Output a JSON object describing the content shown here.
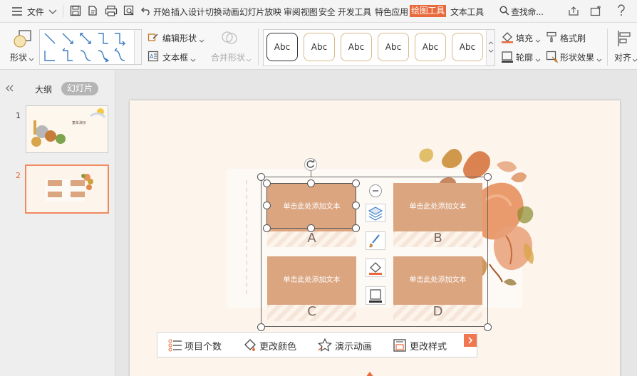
{
  "menubar": {
    "file_label": "文件",
    "tabs": [
      "开始",
      "插入",
      "设计",
      "切换",
      "动画",
      "幻灯片放映",
      "审阅",
      "视图",
      "安全",
      "开发工具",
      "特色应用",
      "绘图工具",
      "文本工具"
    ],
    "search_label": "查找命..."
  },
  "ribbon": {
    "shape_label": "形状",
    "edit_shape_label": "编辑形状",
    "textbox_label": "文本框",
    "merge_shape_label": "合并形状",
    "style_samples": [
      "Abc",
      "Abc",
      "Abc",
      "Abc",
      "Abc",
      "Abc"
    ],
    "fill_label": "填充",
    "format_painter_label": "格式刷",
    "outline_label": "轮廓",
    "shape_effect_label": "形状效果",
    "align_label": "对齐"
  },
  "left_panel": {
    "tab_outline": "大纲",
    "tab_slides": "幻灯片",
    "slides": [
      {
        "number": "1",
        "title": "童年演示"
      },
      {
        "number": "2"
      }
    ]
  },
  "slide": {
    "cards": [
      {
        "text": "单击此处添加文本",
        "letter": "A"
      },
      {
        "text": "单击此处添加文本",
        "letter": "B"
      },
      {
        "text": "单击此处添加文本",
        "letter": "C"
      },
      {
        "text": "单击此处添加文本",
        "letter": "D"
      }
    ]
  },
  "bottom_toolbar": {
    "items": [
      "项目个数",
      "更改颜色",
      "演示动画",
      "更改样式"
    ]
  },
  "colors": {
    "accent": "#e8693b",
    "card": "#dba580",
    "slide_bg": "#fdf4ec"
  }
}
